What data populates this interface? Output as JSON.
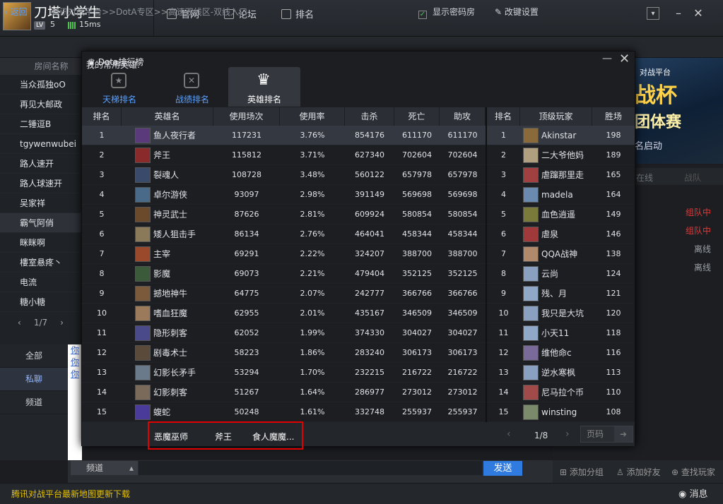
{
  "top": {
    "username": "刀塔小学生",
    "level_badge": "LV",
    "level": "5",
    "ping": "15ms",
    "nav": [
      {
        "label": "官网"
      },
      {
        "label": "论坛"
      },
      {
        "label": "排名"
      }
    ]
  },
  "breadcrumb": {
    "back": "返回",
    "path": "腾讯对战平台>>DotA专区>>高速双线区-双线入口",
    "show_password": "显示密码房",
    "settings": "改键设置"
  },
  "left": {
    "header": "房间名称",
    "players": [
      "当众孤独oO",
      "再见大邮政",
      "二锤逗B",
      "tgywenwubei",
      "路人速开",
      "路人球速开",
      "吴家祥",
      "霸气阿俏",
      "眯眯啊",
      "樓室悬疼丶",
      "电流",
      "糖小糖"
    ],
    "page": "1/7",
    "chat_tabs": [
      "全部",
      "私聊",
      "频道"
    ],
    "chat_links": [
      "你",
      "你",
      "你"
    ]
  },
  "right": {
    "banner_line1": "对战平台",
    "banner_line2": "战杯",
    "banner_line3": "团体赛",
    "banner_line4": "名启动",
    "tab_online": "在线",
    "tab_team": "战队",
    "statuses": [
      {
        "text": "组队中",
        "color": "#e03a3a"
      },
      {
        "text": "组队中",
        "color": "#e03a3a"
      },
      {
        "text": "离线",
        "color": "#9aa0a6"
      },
      {
        "text": "离线",
        "color": "#9aa0a6"
      }
    ],
    "add_group": "添加分组",
    "add_friend": "添加好友",
    "find_player": "查找玩家"
  },
  "chat": {
    "channel": "频道",
    "send": "发送"
  },
  "status_bar": {
    "news": "腾讯对战平台最新地图更新下载",
    "messages": "消息"
  },
  "dialog": {
    "title": "Dota排行榜",
    "tabs": [
      "天梯排名",
      "战绩排名",
      "英雄排名"
    ],
    "hero_headers": [
      "排名",
      "英雄名",
      "使用场次",
      "使用率",
      "击杀",
      "死亡",
      "助攻"
    ],
    "player_headers": [
      "排名",
      "顶级玩家",
      "胜场"
    ],
    "heroes": [
      {
        "rank": "1",
        "name": "鱼人夜行者",
        "games": "117231",
        "rate": "3.76%",
        "kills": "854176",
        "deaths": "611170",
        "assists": "611170",
        "color": "#5a3a7a",
        "player": "Akinstar",
        "wins": "198",
        "pcolor": "#8a6a3a"
      },
      {
        "rank": "2",
        "name": "斧王",
        "games": "115812",
        "rate": "3.71%",
        "kills": "627340",
        "deaths": "702604",
        "assists": "702604",
        "color": "#8a2a2a",
        "player": "二大爷他妈",
        "wins": "189",
        "pcolor": "#b0a080"
      },
      {
        "rank": "3",
        "name": "裂魂人",
        "games": "108728",
        "rate": "3.48%",
        "kills": "560122",
        "deaths": "657978",
        "assists": "657978",
        "color": "#3a4a6a",
        "player": "虐蹿那里走",
        "wins": "165",
        "pcolor": "#a04040"
      },
      {
        "rank": "4",
        "name": "卓尔游侠",
        "games": "93097",
        "rate": "2.98%",
        "kills": "391149",
        "deaths": "569698",
        "assists": "569698",
        "color": "#4a6a8a",
        "player": "madela",
        "wins": "164",
        "pcolor": "#6a8ab0"
      },
      {
        "rank": "5",
        "name": "神灵武士",
        "games": "87626",
        "rate": "2.81%",
        "kills": "609924",
        "deaths": "580854",
        "assists": "580854",
        "color": "#6a4a2a",
        "player": "血色逍遥",
        "wins": "149",
        "pcolor": "#7a7a3a"
      },
      {
        "rank": "6",
        "name": "矮人狙击手",
        "games": "86134",
        "rate": "2.76%",
        "kills": "464041",
        "deaths": "458344",
        "assists": "458344",
        "color": "#8a7a5a",
        "player": "虐泉",
        "wins": "146",
        "pcolor": "#a03a3a"
      },
      {
        "rank": "7",
        "name": "主宰",
        "games": "69291",
        "rate": "2.22%",
        "kills": "324207",
        "deaths": "388700",
        "assists": "388700",
        "color": "#9a4a2a",
        "player": "QQA战神",
        "wins": "138",
        "pcolor": "#b08a6a"
      },
      {
        "rank": "8",
        "name": "影魔",
        "games": "69073",
        "rate": "2.21%",
        "kills": "479404",
        "deaths": "352125",
        "assists": "352125",
        "color": "#3a5a3a",
        "player": "云尚",
        "wins": "124",
        "pcolor": "#8aa0c0"
      },
      {
        "rank": "9",
        "name": "撼地神牛",
        "games": "64775",
        "rate": "2.07%",
        "kills": "242777",
        "deaths": "366766",
        "assists": "366766",
        "color": "#7a5a3a",
        "player": "残、月",
        "wins": "121",
        "pcolor": "#90a8c8"
      },
      {
        "rank": "10",
        "name": "嗜血狂魔",
        "games": "62955",
        "rate": "2.01%",
        "kills": "435167",
        "deaths": "346509",
        "assists": "346509",
        "color": "#9a7a5a",
        "player": "我只是大坑",
        "wins": "120",
        "pcolor": "#8aa0c0"
      },
      {
        "rank": "11",
        "name": "隐形刺客",
        "games": "62052",
        "rate": "1.99%",
        "kills": "374330",
        "deaths": "304027",
        "assists": "304027",
        "color": "#4a4a8a",
        "player": "小天11",
        "wins": "118",
        "pcolor": "#90a8c8"
      },
      {
        "rank": "12",
        "name": "剧毒术士",
        "games": "58223",
        "rate": "1.86%",
        "kills": "283240",
        "deaths": "306173",
        "assists": "306173",
        "color": "#5a4a3a",
        "player": "维他命c",
        "wins": "116",
        "pcolor": "#7a6a9a"
      },
      {
        "rank": "13",
        "name": "幻影长矛手",
        "games": "53294",
        "rate": "1.70%",
        "kills": "232215",
        "deaths": "216722",
        "assists": "216722",
        "color": "#6a7a8a",
        "player": "逆水寒枫",
        "wins": "113",
        "pcolor": "#8aa0c0"
      },
      {
        "rank": "14",
        "name": "幻影刺客",
        "games": "51267",
        "rate": "1.64%",
        "kills": "286977",
        "deaths": "273012",
        "assists": "273012",
        "color": "#7a6a5a",
        "player": "尼马拉个币",
        "wins": "110",
        "pcolor": "#a04a4a"
      },
      {
        "rank": "15",
        "name": "蝮蛇",
        "games": "50248",
        "rate": "1.61%",
        "kills": "332748",
        "deaths": "255937",
        "assists": "255937",
        "color": "#4a3a9a",
        "player": "winsting",
        "wins": "108",
        "pcolor": "#7a8a6a"
      }
    ],
    "fav_label": "我的常用英雄:",
    "fav_heroes": [
      "恶魔巫师",
      "斧王",
      "食人魔魔..."
    ],
    "page": "1/8",
    "page_placeholder": "页码"
  }
}
